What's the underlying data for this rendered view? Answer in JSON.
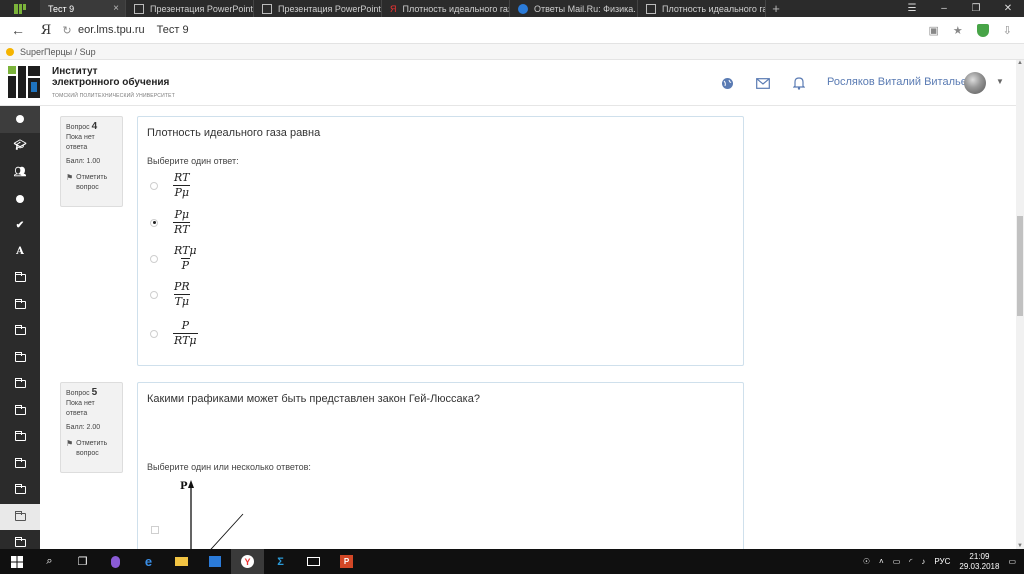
{
  "browser": {
    "tabs": [
      {
        "label": "Тест 9",
        "active": true
      },
      {
        "label": "Презентация PowerPoint",
        "active": false
      },
      {
        "label": "Презентация PowerPoint",
        "active": false
      },
      {
        "label": "Плотность идеального газа",
        "active": false
      },
      {
        "label": "Ответы Mail.Ru: Физика. Мо",
        "active": false
      },
      {
        "label": "Плотность идеального газа",
        "active": false
      }
    ],
    "address": {
      "domain": "eor.lms.tpu.ru",
      "page_title": "Тест 9"
    },
    "bookmark": "SuperПерцы / Sup"
  },
  "site": {
    "institute_line1": "Институт",
    "institute_line2": "электронного обучения",
    "university": "ТОМСКИЙ ПОЛИТЕХНИЧЕСКИЙ УНИВЕРСИТЕТ",
    "user_name": "Росляков Виталий Витальевич"
  },
  "questions": [
    {
      "label": "Вопрос",
      "number": "4",
      "status": "Пока нет ответа",
      "grade": "Балл: 1.00",
      "flag": "Отметить вопрос",
      "text": "Плотность идеального газа равна",
      "prompt": "Выберите один ответ:",
      "answers": [
        {
          "num": "RT",
          "den": "Pμ",
          "checked": false
        },
        {
          "num": "Pμ",
          "den": "RT",
          "checked": true
        },
        {
          "num": "RTμ",
          "den": "P",
          "checked": false
        },
        {
          "num": "PR",
          "den": "Tμ",
          "checked": false
        },
        {
          "num": "P",
          "den": "RTμ",
          "checked": false
        }
      ]
    },
    {
      "label": "Вопрос",
      "number": "5",
      "status": "Пока нет ответа",
      "grade": "Балл: 2.00",
      "flag": "Отметить вопрос",
      "text": "Какими графиками может быть представлен закон Гей-Люссака?",
      "prompt": "Выберите один или несколько ответов:",
      "graph_axis_label": "P"
    }
  ],
  "taskbar": {
    "lang": "РУС",
    "time": "21:09",
    "date": "29.03.2018"
  }
}
